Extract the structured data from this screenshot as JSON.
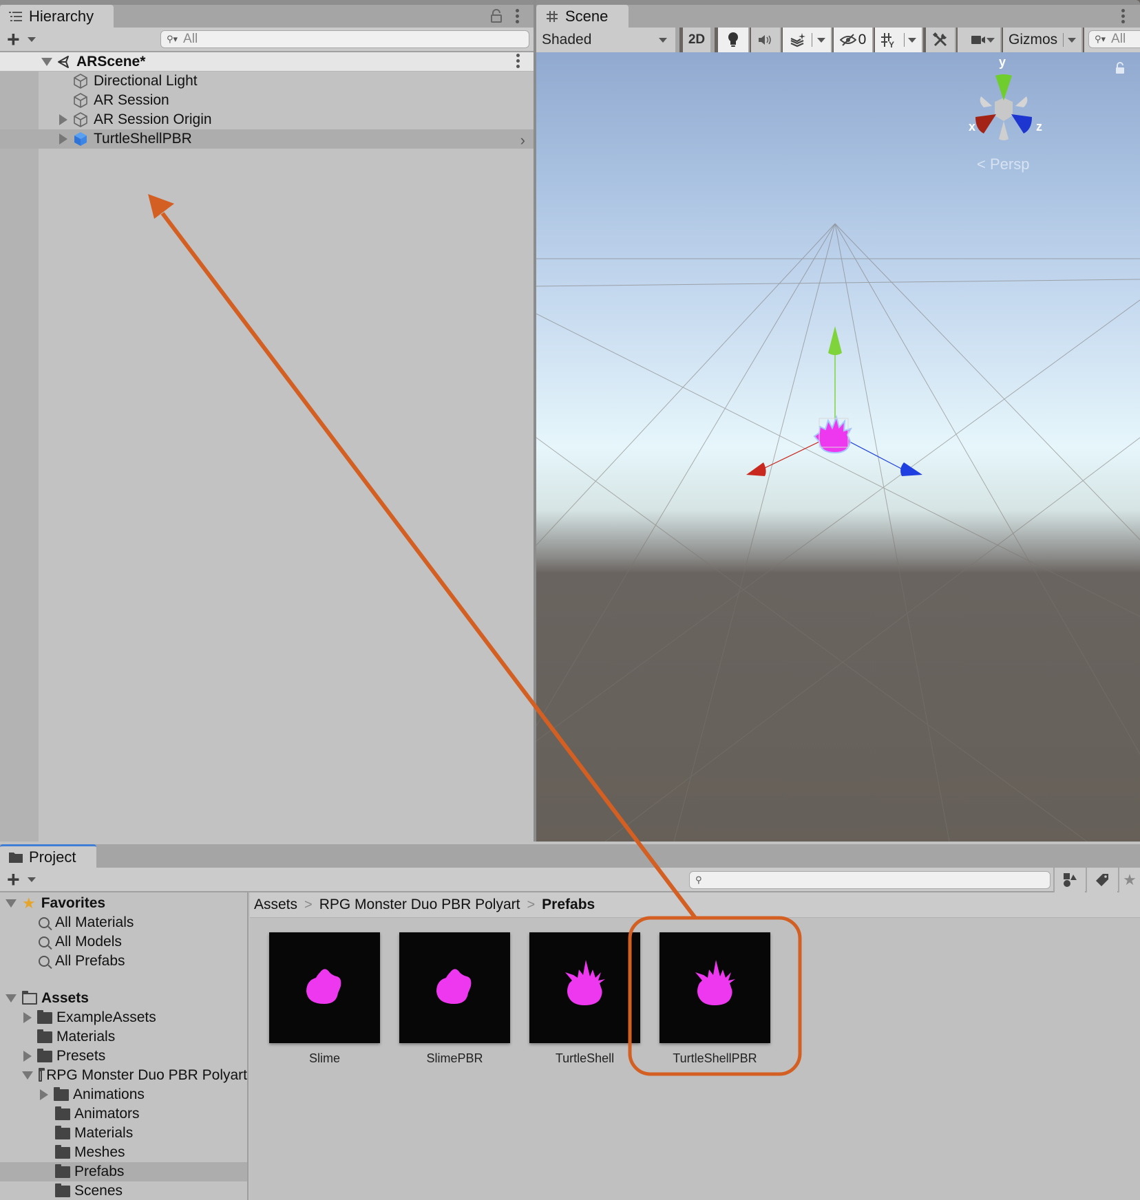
{
  "hierarchy": {
    "tab_label": "Hierarchy",
    "tab_icon": "list-icon",
    "search_placeholder": "All",
    "scene_name": "ARScene*",
    "items": [
      {
        "label": "Directional Light",
        "icon": "gameobject-icon",
        "expandable": false
      },
      {
        "label": "AR Session",
        "icon": "gameobject-icon",
        "expandable": false
      },
      {
        "label": "AR Session Origin",
        "icon": "gameobject-icon",
        "expandable": true
      },
      {
        "label": "TurtleShellPBR",
        "icon": "prefab-icon",
        "expandable": true,
        "selected": true
      }
    ]
  },
  "scene": {
    "tab_label": "Scene",
    "tab_icon": "grid-icon",
    "shading_mode": "Shaded",
    "toggle_2d": "2D",
    "hidden_count": "0",
    "gizmos_label": "Gizmos",
    "search_placeholder": "All",
    "orientation_gizmo": {
      "x_label": "x",
      "y_label": "y",
      "z_label": "z",
      "projection": "Persp"
    }
  },
  "project": {
    "tab_label": "Project",
    "favorites": {
      "label": "Favorites",
      "items": [
        "All Materials",
        "All Models",
        "All Prefabs"
      ]
    },
    "tree": {
      "root": "Assets",
      "items": [
        {
          "label": "ExampleAssets",
          "level": 1,
          "expandable": true
        },
        {
          "label": "Materials",
          "level": 1,
          "expandable": false
        },
        {
          "label": "Presets",
          "level": 1,
          "expandable": true
        },
        {
          "label": "RPG Monster Duo PBR Polyart",
          "level": 1,
          "expandable": true,
          "open": true
        },
        {
          "label": "Animations",
          "level": 2,
          "expandable": true
        },
        {
          "label": "Animators",
          "level": 2,
          "expandable": false
        },
        {
          "label": "Materials",
          "level": 2,
          "expandable": false
        },
        {
          "label": "Meshes",
          "level": 2,
          "expandable": false
        },
        {
          "label": "Prefabs",
          "level": 2,
          "expandable": false,
          "selected": true
        },
        {
          "label": "Scenes",
          "level": 2,
          "expandable": false
        }
      ]
    },
    "breadcrumb": [
      "Assets",
      "RPG Monster Duo PBR Polyart",
      "Prefabs"
    ],
    "assets": [
      {
        "name": "Slime",
        "shape": "slime"
      },
      {
        "name": "SlimePBR",
        "shape": "slime"
      },
      {
        "name": "TurtleShell",
        "shape": "turtleshell"
      },
      {
        "name": "TurtleShellPBR",
        "shape": "turtleshell",
        "highlighted": true
      }
    ]
  },
  "annotation": {
    "color": "#d35f22",
    "description": "Arrow from TurtleShellPBR prefab to Hierarchy panel"
  },
  "colors": {
    "missing_material_magenta": "#ee38f0",
    "axis_x": "#c9281e",
    "axis_y": "#7ed43a",
    "axis_z": "#1f3fe0",
    "selection_accent": "#3f7ed6"
  }
}
